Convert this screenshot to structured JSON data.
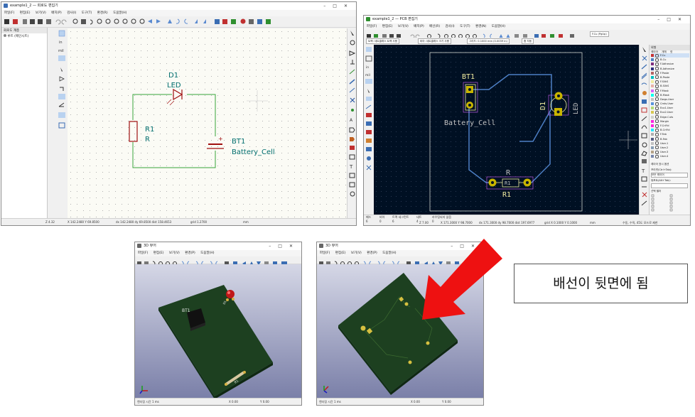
{
  "schematic_window": {
    "title": "example1_2 — 회로도 편집기",
    "menu": [
      "파일(F)",
      "편집(E)",
      "보기(V)",
      "배치(P)",
      "검사(I)",
      "도구(T)",
      "환경(R)",
      "도움말(H)"
    ],
    "panel_header": "회로도 계층",
    "panel_root": "루트 (메인시트)",
    "components": {
      "d1_ref": "D1",
      "d1_value": "LED",
      "r1_ref": "R1",
      "r1_value": "R",
      "bt1_ref": "BT1",
      "bt1_value": "Battery_Cell",
      "bt1_plus": "+"
    },
    "status": {
      "zoom": "Z 4.32",
      "xy": "X 142.2480  Y 69.8500",
      "dxdy": "dx 142.2480  dy 69.8500  dist 158.4653",
      "grid": "grid 1.2700",
      "units": "mm"
    },
    "colors": {
      "wire": "#3aa63a",
      "component": "#a01010",
      "label": "#006e6e"
    }
  },
  "pcb_window": {
    "title": "example1_2 — PCB 편집기",
    "menu": [
      "파일(F)",
      "편집(E)",
      "보기(V)",
      "배치(P)",
      "배선(R)",
      "검사(I)",
      "도구(T)",
      "환경(N)",
      "도움말(H)"
    ],
    "layer_select": "F.Cu (PgUp)",
    "track_select": "트랙: 네트클래스 트랙 사용",
    "via_select": "비아: 네트클래스 크기 사용",
    "grid_select": "그리드: 0.1000 mm (0.0039 in)",
    "zoom_select": "줌 자동",
    "board": {
      "bt1_ref": "BT1",
      "bt1_value": "Battery_Cell",
      "d1_ref": "D1",
      "d1_value": "LED",
      "r1_ref": "R",
      "r1_value": "R1",
      "r1_pad_label": "R1"
    },
    "layers_panel": {
      "header": "외형",
      "tabs": [
        "레이어",
        "개체",
        "넷"
      ],
      "layers": [
        {
          "name": "F.Cu",
          "color": "#c83434"
        },
        {
          "name": "B.Cu",
          "color": "#4d7fc4"
        },
        {
          "name": "F.Adhesive",
          "color": "#7f2f7f"
        },
        {
          "name": "B.Adhesive",
          "color": "#2f2f7f"
        },
        {
          "name": "F.Paste",
          "color": "#b46464"
        },
        {
          "name": "B.Paste",
          "color": "#00c2c2"
        },
        {
          "name": "F.SilkS",
          "color": "#f2eda1"
        },
        {
          "name": "B.SilkS",
          "color": "#e8b2a7"
        },
        {
          "name": "F.Mask",
          "color": "#d864ff"
        },
        {
          "name": "B.Mask",
          "color": "#02ffee"
        },
        {
          "name": "Dwgs.User",
          "color": "#c2c2c2"
        },
        {
          "name": "Cmts.User",
          "color": "#5994dc"
        },
        {
          "name": "Eco1.User",
          "color": "#b4db77"
        },
        {
          "name": "Eco2.User",
          "color": "#d8c852"
        },
        {
          "name": "Edge.Cuts",
          "color": "#d0d2cd"
        },
        {
          "name": "Margin",
          "color": "#ff26e2"
        },
        {
          "name": "F.CrtYd",
          "color": "#ff26e2"
        },
        {
          "name": "B.CrtYd",
          "color": "#26e9ff"
        },
        {
          "name": "F.Fab",
          "color": "#afafaf"
        },
        {
          "name": "B.Fab",
          "color": "#585d84"
        },
        {
          "name": "User.1",
          "color": "#c2c2c2"
        },
        {
          "name": "User.2",
          "color": "#899fb5"
        },
        {
          "name": "User.3",
          "color": "#b5a389"
        },
        {
          "name": "User.4",
          "color": "#7a89ad"
        }
      ],
      "display_header": "레이어 표시 옵션",
      "preset_label": "프리셋(Ctrl+Tab):",
      "preset_value": "모든 레이어",
      "viewport_label": "뷰포트(Alt+Tab):",
      "selection_header": "선택 필터"
    },
    "status": {
      "pads": "패드",
      "pads_val": "6",
      "vias": "비아",
      "vias_val": "0",
      "track_seg": "트랙 세그먼트",
      "track_seg_val": "6",
      "nets": "네트",
      "nets_val": "4",
      "unrouted": "라우팅되지 않음",
      "unrouted_val": "0",
      "zoom": "Z 7.00",
      "xy": "X 171.3000  Y 98.7000",
      "dxdy": "dx 171.3000  dy 98.7000  dist 197.6977",
      "grid": "grid X 0.1000  Y 0.1000",
      "units": "mm",
      "mode": "수동, 수직, 45도 모드로 제한"
    }
  },
  "viewer1": {
    "title": "3D 뷰어",
    "menu": [
      "파일(F)",
      "편집(E)",
      "보기(V)",
      "환경(P)",
      "도움말(H)"
    ],
    "labels": {
      "bt1": "BT1",
      "r1": "R1",
      "d1": "D1"
    },
    "status": "렌더링 시간 1 ms",
    "x": "X 0.00",
    "y": "Y 0.00"
  },
  "viewer2": {
    "title": "3D 뷰어",
    "menu": [
      "파일(F)",
      "편집(E)",
      "보기(V)",
      "환경(P)",
      "도움말(H)"
    ],
    "status": "렌더링 시간 1 ms",
    "x": "X 0.00",
    "y": "Y 0.00"
  },
  "annotation": {
    "text": "배선이 뒷면에 됨",
    "arrow_color": "#ee1111"
  }
}
